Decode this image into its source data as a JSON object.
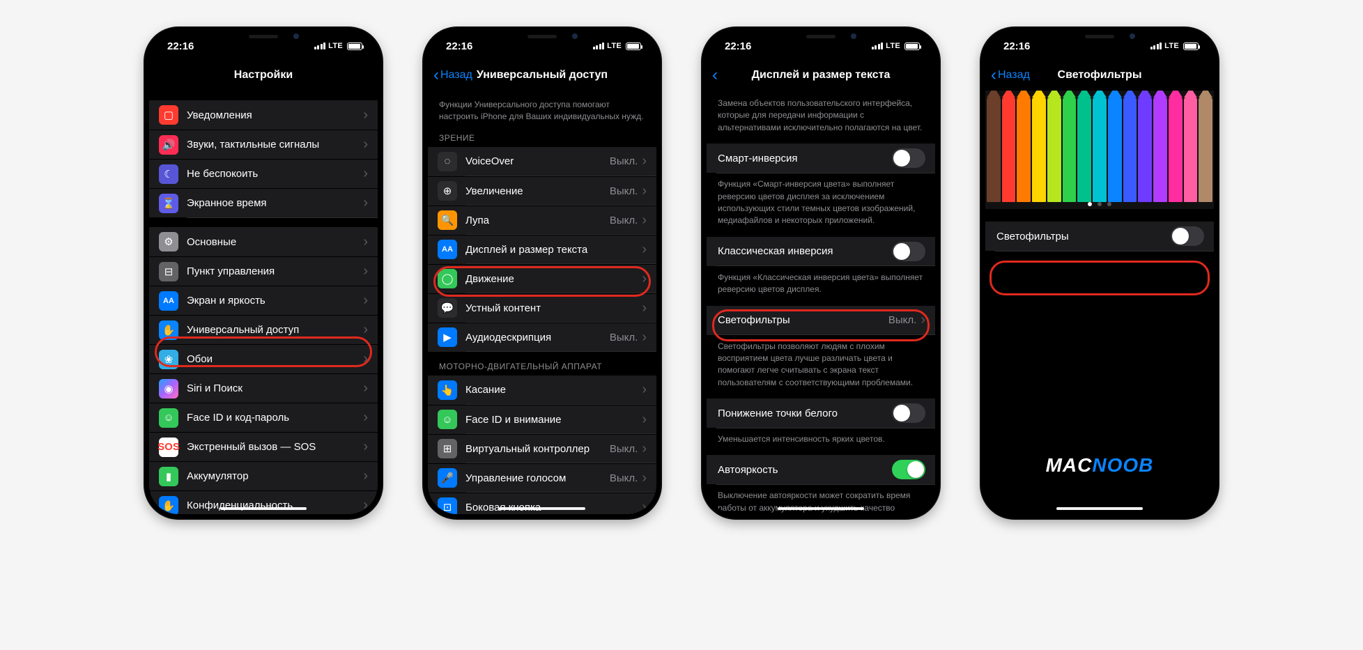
{
  "status": {
    "time": "22:16",
    "carrier": "LTE"
  },
  "phone1": {
    "title": "Настройки",
    "groupA": [
      {
        "icon": "notify",
        "label": "Уведомления"
      },
      {
        "icon": "sound",
        "label": "Звуки, тактильные сигналы"
      },
      {
        "icon": "dnd",
        "label": "Не беспокоить"
      },
      {
        "icon": "screen",
        "label": "Экранное время"
      }
    ],
    "groupB": [
      {
        "icon": "general",
        "label": "Основные"
      },
      {
        "icon": "control",
        "label": "Пункт управления"
      },
      {
        "icon": "display",
        "label": "Экран и яркость"
      },
      {
        "icon": "access",
        "label": "Универсальный доступ"
      },
      {
        "icon": "wall",
        "label": "Обои"
      },
      {
        "icon": "siri",
        "label": "Siri и Поиск"
      },
      {
        "icon": "faceid",
        "label": "Face ID и код-пароль"
      },
      {
        "icon": "sos",
        "label": "Экстренный вызов — SOS"
      },
      {
        "icon": "battery",
        "label": "Аккумулятор"
      },
      {
        "icon": "privacy",
        "label": "Конфиденциальность"
      }
    ]
  },
  "phone2": {
    "back": "Назад",
    "title": "Универсальный доступ",
    "intro": "Функции Универсального доступа помогают настроить iPhone для Ваших индивидуальных нужд.",
    "h1": "ЗРЕНИЕ",
    "vision": [
      {
        "label": "VoiceOver",
        "value": "Выкл."
      },
      {
        "label": "Увеличение",
        "value": "Выкл."
      },
      {
        "label": "Лупа",
        "value": "Выкл."
      },
      {
        "label": "Дисплей и размер текста",
        "value": ""
      },
      {
        "label": "Движение",
        "value": ""
      },
      {
        "label": "Устный контент",
        "value": ""
      },
      {
        "label": "Аудиодескрипция",
        "value": "Выкл."
      }
    ],
    "h2": "МОТОРНО-ДВИГАТЕЛЬНЫЙ АППАРАТ",
    "motor": [
      {
        "label": "Касание",
        "value": ""
      },
      {
        "label": "Face ID и внимание",
        "value": ""
      },
      {
        "label": "Виртуальный контроллер",
        "value": "Выкл."
      },
      {
        "label": "Управление голосом",
        "value": "Выкл."
      },
      {
        "label": "Боковая кнопка",
        "value": ""
      }
    ]
  },
  "phone3": {
    "title": "Дисплей и размер текста",
    "intro": "Замена объектов пользовательского интерфейса, которые для передачи информации с альтернативами исключительно полагаются на цвет.",
    "smart": {
      "label": "Смарт-инверсия",
      "on": false
    },
    "smart_foot": "Функция «Смарт-инверсия цвета» выполняет реверсию цветов дисплея за исключением использующих стили темных цветов изображений, медиафайлов и некоторых приложений.",
    "classic": {
      "label": "Классическая инверсия",
      "on": false
    },
    "classic_foot": "Функция «Классическая инверсия цвета» выполняет реверсию цветов дисплея.",
    "filters": {
      "label": "Светофильтры",
      "value": "Выкл."
    },
    "filters_foot": "Светофильтры позволяют людям с плохим восприятием цвета лучше различать цвета и помогают легче считывать с экрана текст пользователям с соответствующими проблемами.",
    "white": {
      "label": "Понижение точки белого",
      "on": false
    },
    "white_foot": "Уменьшается интенсивность ярких цветов.",
    "auto": {
      "label": "Автояркость",
      "on": true
    },
    "auto_foot": "Выключение автояркости может сократить время работы от аккумулятора и ухудшить качество отображения на экране в долгосрочной перспективе."
  },
  "phone4": {
    "back": "Назад",
    "title": "Светофильтры",
    "toggle": {
      "label": "Светофильтры",
      "on": false
    },
    "brand1": "MAC",
    "brand2": "NOOB",
    "pencil_colors": [
      "#6b3f2a",
      "#ff3b30",
      "#ff7a00",
      "#ffd400",
      "#b6e61d",
      "#2fd14a",
      "#00c08b",
      "#00c2d1",
      "#0a84ff",
      "#3a5bff",
      "#6f3cff",
      "#b13cff",
      "#ff2da0",
      "#ff5fa2",
      "#b08968"
    ]
  }
}
